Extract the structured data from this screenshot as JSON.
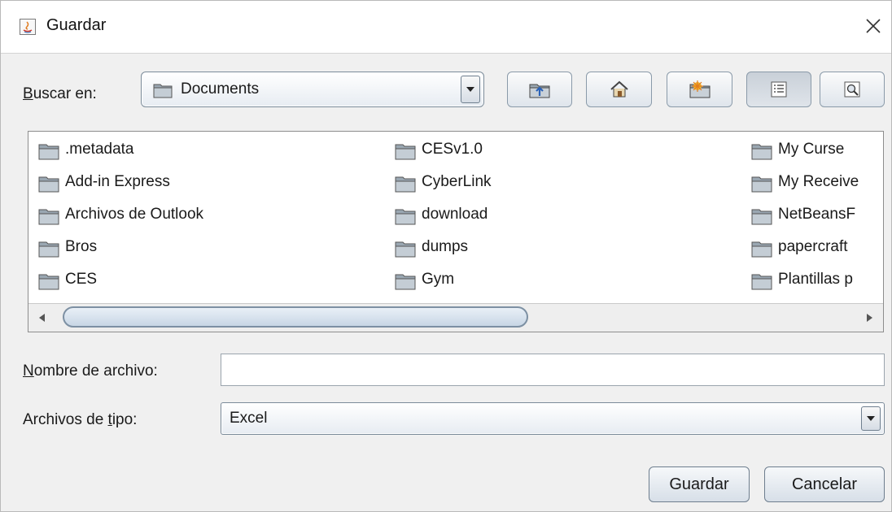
{
  "window": {
    "title": "Guardar"
  },
  "lookin": {
    "label_mnemonic": "B",
    "label_rest": "uscar en:",
    "value": "Documents"
  },
  "toolbar": [
    {
      "name": "up-one-level-button",
      "icon": "folder-up-icon"
    },
    {
      "name": "home-button",
      "icon": "home-icon"
    },
    {
      "name": "new-folder-button",
      "icon": "new-folder-icon"
    },
    {
      "name": "list-view-button",
      "icon": "list-view-icon",
      "pressed": true
    },
    {
      "name": "details-view-button",
      "icon": "details-view-icon"
    }
  ],
  "files": {
    "col1": [
      ".metadata",
      "Add-in Express",
      "Archivos de Outlook",
      "Bros",
      "CES"
    ],
    "col2": [
      "CESv1.0",
      "CyberLink",
      "download",
      "dumps",
      "Gym"
    ],
    "col3": [
      "My Curse",
      "My Receive",
      "NetBeansF",
      "papercraft",
      "Plantillas p"
    ]
  },
  "filename": {
    "label_mnemonic": "N",
    "label_rest": "ombre de archivo:",
    "value": ""
  },
  "filetype": {
    "label_pre": "Archivos de ",
    "label_mnemonic": "t",
    "label_post": "ipo:",
    "value": "Excel"
  },
  "buttons": {
    "save": "Guardar",
    "cancel": "Cancelar"
  },
  "colors": {
    "folder": "#8c9aa6",
    "accent": "#7d90a3"
  }
}
